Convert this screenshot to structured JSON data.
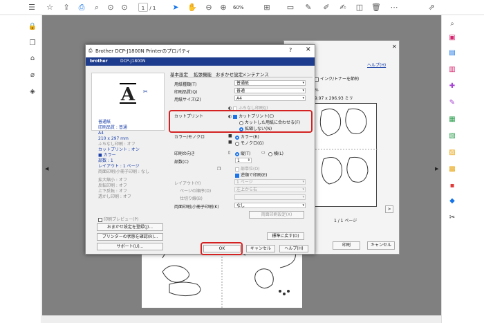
{
  "toolbar": {
    "page_current": "1",
    "page_total": "/ 1",
    "zoom": "60%"
  },
  "bg_dialog": {
    "help": "ヘルプ(H)",
    "ink_saving": "インク/トナーを節約",
    "paper_size": "9.97 x 296.93 ミリ",
    "page_counter": "1 / 1 ページ",
    "print_button": "印刷",
    "cancel_button": "キャンセル",
    "percent": "%",
    "next": ">"
  },
  "dialog": {
    "title": "Brother DCP-J1800N Printerのプロパティ",
    "brand": "brother",
    "model": "DCP-J1800N",
    "summary": {
      "paper_type": "普通紙",
      "quality": "印刷品質 : 普通",
      "size": "A4",
      "dims": "210 x 297 mm",
      "borderless": "ふちなし印刷 : オフ",
      "cut_print": "カットプリント : オン",
      "color_label": "カラー",
      "copies": "部数 : 1",
      "layout": "レイアウト : 1 ページ",
      "duplex": "両面印刷/小冊子印刷 : なし",
      "scaling": "拡大縮小 : オフ",
      "reverse": "反転印刷 : オフ",
      "upside": "上下反転 : オフ",
      "watermark": "透かし印刷 : オフ"
    },
    "preview_check": "印刷プレビュー(P)",
    "buttons": {
      "register": "おまかせ設定を登録(J)...",
      "status": "プリンターの状態を確認(R)...",
      "support": "サポート(U)...",
      "default": "標準に戻す(D)",
      "ok": "OK",
      "cancel": "キャンセル",
      "help": "ヘルプ(H)",
      "duplex_settings": "両面印刷設定(X)"
    },
    "tabs": [
      "基本設定",
      "拡張機能",
      "おまかせ設定",
      "メンテナンス"
    ],
    "labels": {
      "paper_type": "用紙種類(T)",
      "quality": "印刷品質(Q)",
      "size": "用紙サイズ(Z)",
      "cut_print": "カットプリント",
      "color_mono": "カラー/モノクロ",
      "orientation": "印刷の向き",
      "copies": "部数(C)",
      "layout": "レイアウト(Y)",
      "page_order": "ページの順序(D)",
      "border": "仕切り線(B)",
      "duplex": "両面印刷/小冊子印刷(K)"
    },
    "values": {
      "paper_type": "普通紙",
      "quality": "普通",
      "size": "A4",
      "borderless": "ふちなし印刷(J)",
      "cut_print": "カットプリント(C)",
      "fit_cut": "カットした用紙に合わせる(F)",
      "no_scale": "拡縮しない(N)",
      "color": "カラー(R)",
      "mono": "モノクロ(G)",
      "portrait": "縦(T)",
      "landscape": "横(L)",
      "copies": "1",
      "collate": "部単位(O)",
      "reverse": "逆順で印刷(E)",
      "layout": "1 ページ",
      "page_order": "左上から右",
      "border": "",
      "duplex": "なし"
    }
  }
}
